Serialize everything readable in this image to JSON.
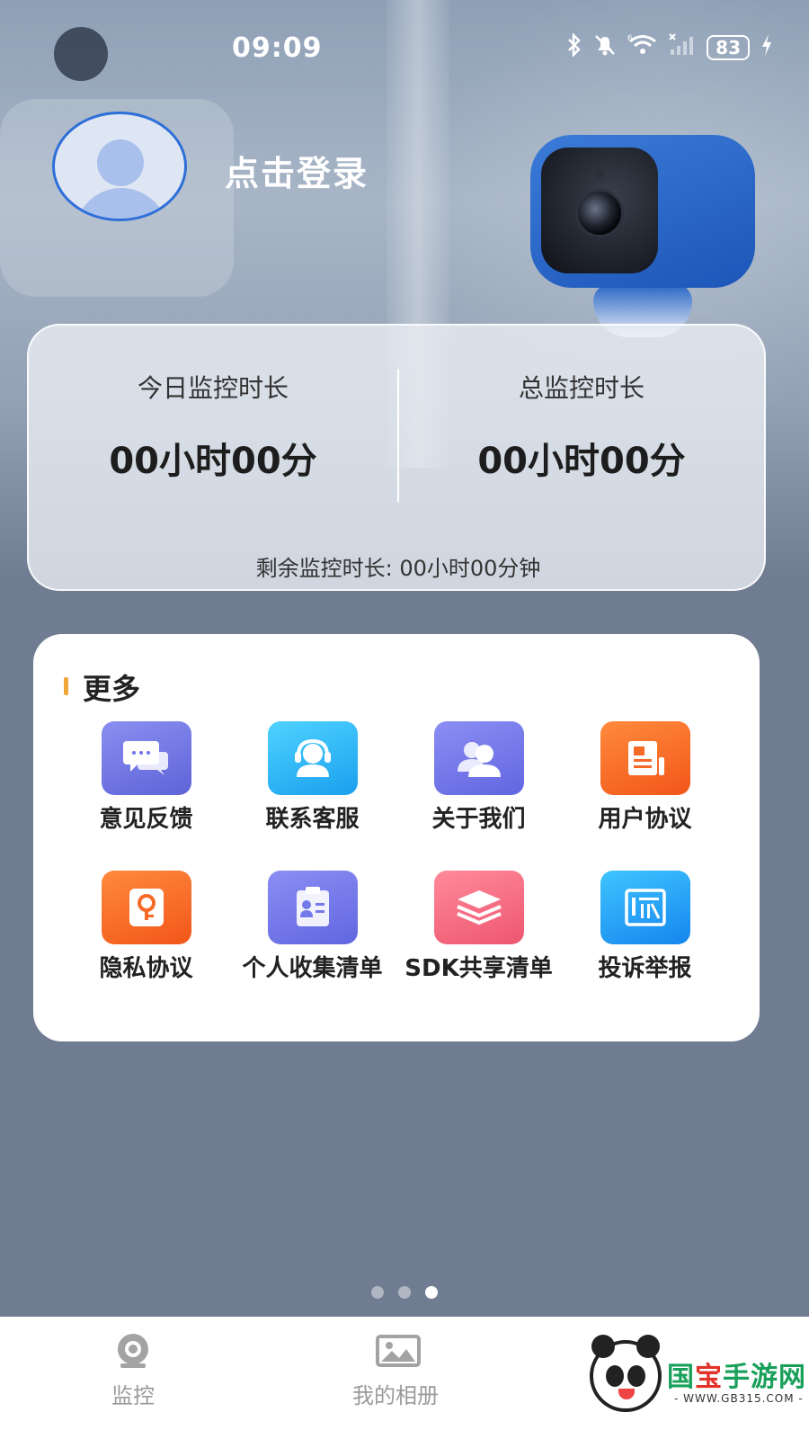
{
  "status_bar": {
    "time": "09:09",
    "network_label": "6",
    "battery": "83"
  },
  "profile": {
    "login_text": "点击登录"
  },
  "stats": {
    "today_label": "今日监控时长",
    "today_value": "00小时00分",
    "total_label": "总监控时长",
    "total_value": "00小时00分",
    "remaining_label": "剩余监控时长:",
    "remaining_value": "00小时00分钟"
  },
  "more": {
    "title": "更多",
    "items": [
      {
        "label": "意见反馈",
        "icon": "feedback-icon",
        "color": "#6f74e6"
      },
      {
        "label": "联系客服",
        "icon": "customer-service-icon",
        "color": "#2bb7f4"
      },
      {
        "label": "关于我们",
        "icon": "about-us-icon",
        "color": "#7479ea"
      },
      {
        "label": "用户协议",
        "icon": "user-agreement-icon",
        "color": "#f66a28"
      },
      {
        "label": "隐私协议",
        "icon": "privacy-icon",
        "color": "#f66a28"
      },
      {
        "label": "个人收集清单",
        "icon": "personal-info-list-icon",
        "color": "#7479ea"
      },
      {
        "label": "SDK共享清单",
        "icon": "sdk-share-icon",
        "color": "#f26a7e"
      },
      {
        "label": "投诉举报",
        "icon": "complaint-icon",
        "color": "#2aa6f3"
      }
    ]
  },
  "pager": {
    "count": 3,
    "active_index": 2
  },
  "nav": {
    "monitor_label": "监控",
    "album_label": "我的相册"
  },
  "watermark": {
    "text_a": "国",
    "text_b": "宝",
    "text_c": "手游网",
    "url": "- WWW.GB315.COM -"
  }
}
